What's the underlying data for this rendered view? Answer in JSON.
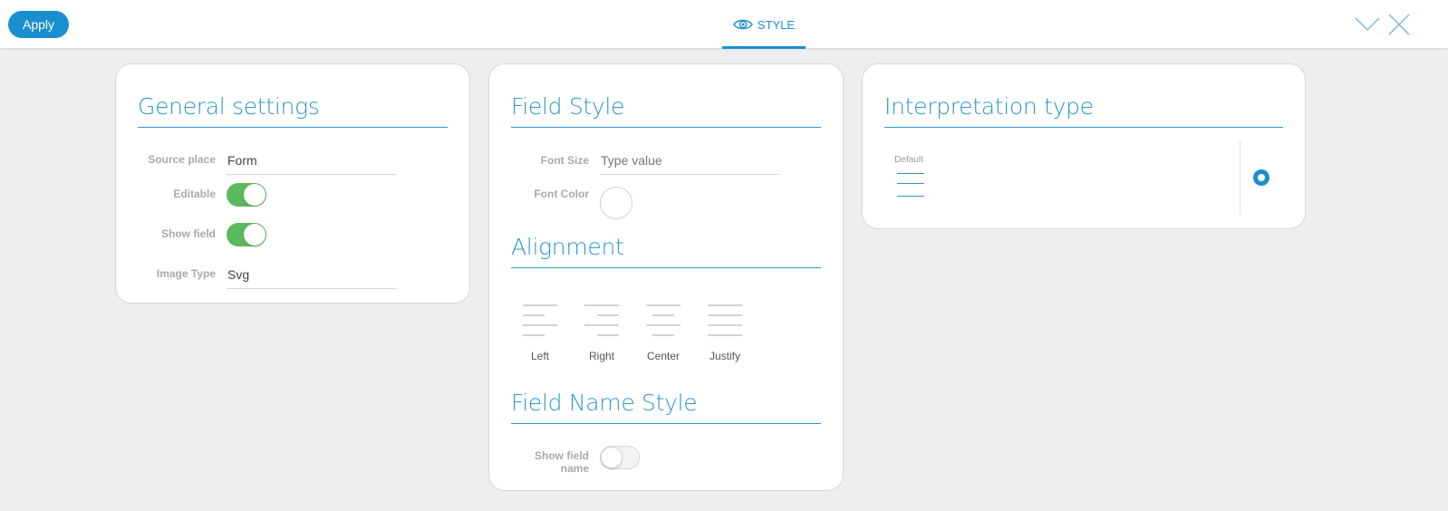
{
  "toolbar": {
    "apply_label": "Apply",
    "tab_label": "STYLE"
  },
  "icons": {
    "tab": "eye-icon",
    "minimize": "chevron-down-icon",
    "close": "close-icon"
  },
  "colors": {
    "accent": "#1a8fd0",
    "title": "#2f97c8",
    "toggle_on": "#5cb85c"
  },
  "general": {
    "title": "General settings",
    "source_place": {
      "label": "Source place",
      "value": "Form"
    },
    "editable": {
      "label": "Editable",
      "on": true
    },
    "show_field": {
      "label": "Show field",
      "on": true
    },
    "image_type": {
      "label": "Image Type",
      "value": "Svg"
    }
  },
  "field_style": {
    "title": "Field Style",
    "font_size": {
      "label": "Font Size",
      "placeholder": "Type value"
    },
    "font_color": {
      "label": "Font Color"
    }
  },
  "alignment": {
    "title": "Alignment",
    "options": [
      {
        "label": "Left"
      },
      {
        "label": "Right"
      },
      {
        "label": "Center"
      },
      {
        "label": "Justify"
      }
    ]
  },
  "field_name_style": {
    "title": "Field Name Style",
    "show_field_name": {
      "label_line1": "Show field",
      "label_line2": "name",
      "on": false
    }
  },
  "interpretation": {
    "title": "Interpretation type",
    "default_label": "Default",
    "selected": true
  }
}
